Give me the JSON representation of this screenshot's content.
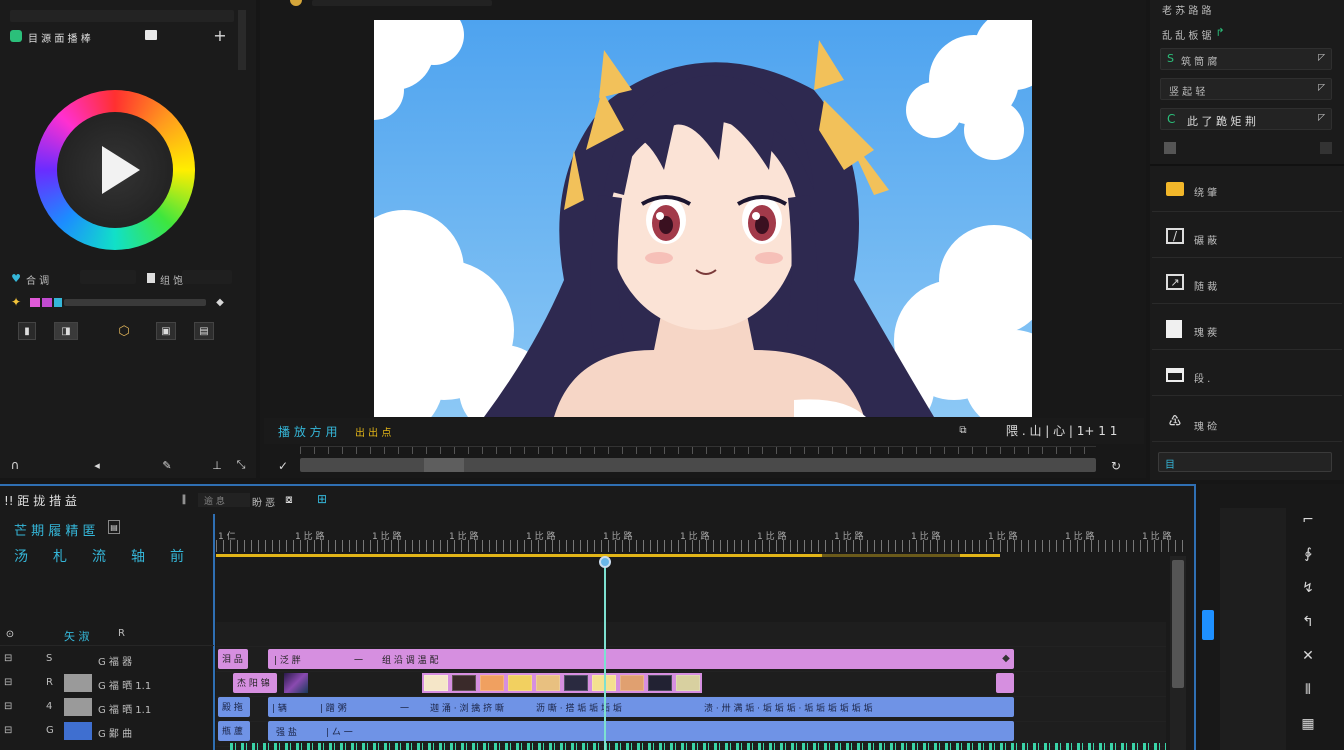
{
  "left_panel": {
    "top_title": "目 源 面 播 棒",
    "wheel_icon": "play-icon",
    "label_a": "合 调",
    "label_b": "组 饱"
  },
  "preview": {
    "label_cyan": "播 放 方 用",
    "label_yellow": "出 出 点",
    "label_right": "隈 . 山 | 心 | 1+ 1 1",
    "scene_description_icon": "anime-girl-image"
  },
  "right_panel": {
    "heading": "老 苏 路 路",
    "sub_heading": "乱 乱 板 锯",
    "rows": [
      "筑 筒 腐",
      "竖 起 轻",
      "此 了 跪 矩 荆"
    ],
    "tools": [
      {
        "icon": "title-icon",
        "label": "绕 肇"
      },
      {
        "icon": "crop-icon",
        "label": "碾 蔽"
      },
      {
        "icon": "transform-icon",
        "label": "随 裁"
      },
      {
        "icon": "panel-icon",
        "label": "瑰 蒺"
      },
      {
        "icon": "caption-icon",
        "label": "段 ."
      },
      {
        "icon": "effect-icon",
        "label": "瑰 硷"
      }
    ],
    "search_value": "目"
  },
  "timeline": {
    "title": "!! 距 拢 措 益",
    "field_value": "逾 息",
    "field_label": "盼 恶",
    "sub_title": "芒 期 履 精 匿",
    "controls": [
      "汤",
      "札",
      "流",
      "轴",
      "前"
    ],
    "track_header": [
      "矢 淑",
      "R"
    ],
    "ruler_labels": [
      "1 仁",
      "1 比 路",
      "1 比 路",
      "1 比 路",
      "1 比 路",
      "1 比 路",
      "1 比 路",
      "1 比 路",
      "1 比 路",
      "1 比 路",
      "1 比 路",
      "1 比 路",
      "1 比 路"
    ],
    "tracks": [
      {
        "name": "G 福 器",
        "key": "S"
      },
      {
        "name": "G 福 晒 1.1",
        "key": "R"
      },
      {
        "name": "G 福 晒 1.1",
        "key": "4"
      },
      {
        "name": "G 鄙 曲",
        "key": "G"
      }
    ],
    "clips_row1": [
      "泪 品",
      "| 泛 胖",
      "一",
      "组 沿 调 温 配"
    ],
    "clips_row2": [
      "杰 阳 锦"
    ],
    "clips_row3": [
      "殿 拖",
      "| 辆",
      "| 蹭 粥",
      "一",
      "迦 涌 · 浏 擒 挤 嘶",
      "沥 嘶 · 搭 垢 垢 垢 垢",
      "溃 · 卅 满 垢 · 垢 垢 垢 · 垢 垢 垢 垢 垢 垢"
    ],
    "clips_row4": [
      "瓶 蘆",
      "强 盐",
      "| 厶 一"
    ]
  },
  "colors": {
    "accent_cyan": "#35b6d8",
    "clip_pink": "#d68fe0",
    "clip_blue": "#6f93e6",
    "playhead": "#7de0d0",
    "work_area": "#e2b518"
  }
}
